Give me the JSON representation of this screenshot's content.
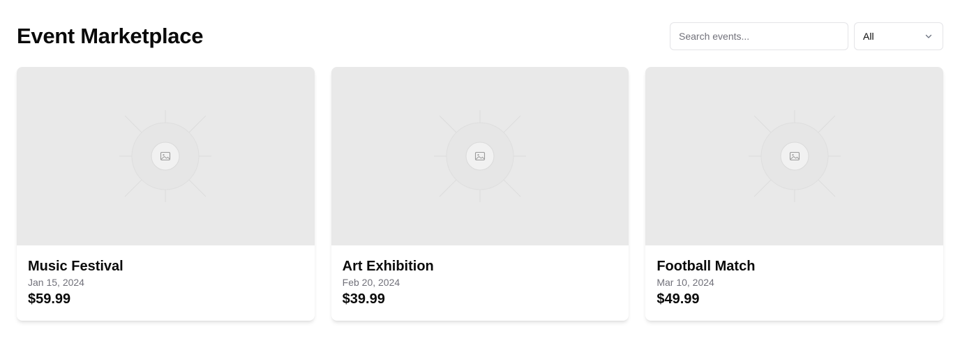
{
  "header": {
    "title": "Event Marketplace",
    "search_placeholder": "Search events...",
    "filter_selected": "All"
  },
  "events": [
    {
      "title": "Music Festival",
      "date": "Jan 15, 2024",
      "price": "$59.99",
      "image_icon": "image-placeholder-icon"
    },
    {
      "title": "Art Exhibition",
      "date": "Feb 20, 2024",
      "price": "$39.99",
      "image_icon": "image-placeholder-icon"
    },
    {
      "title": "Football Match",
      "date": "Mar 10, 2024",
      "price": "$49.99",
      "image_icon": "image-placeholder-icon"
    }
  ]
}
